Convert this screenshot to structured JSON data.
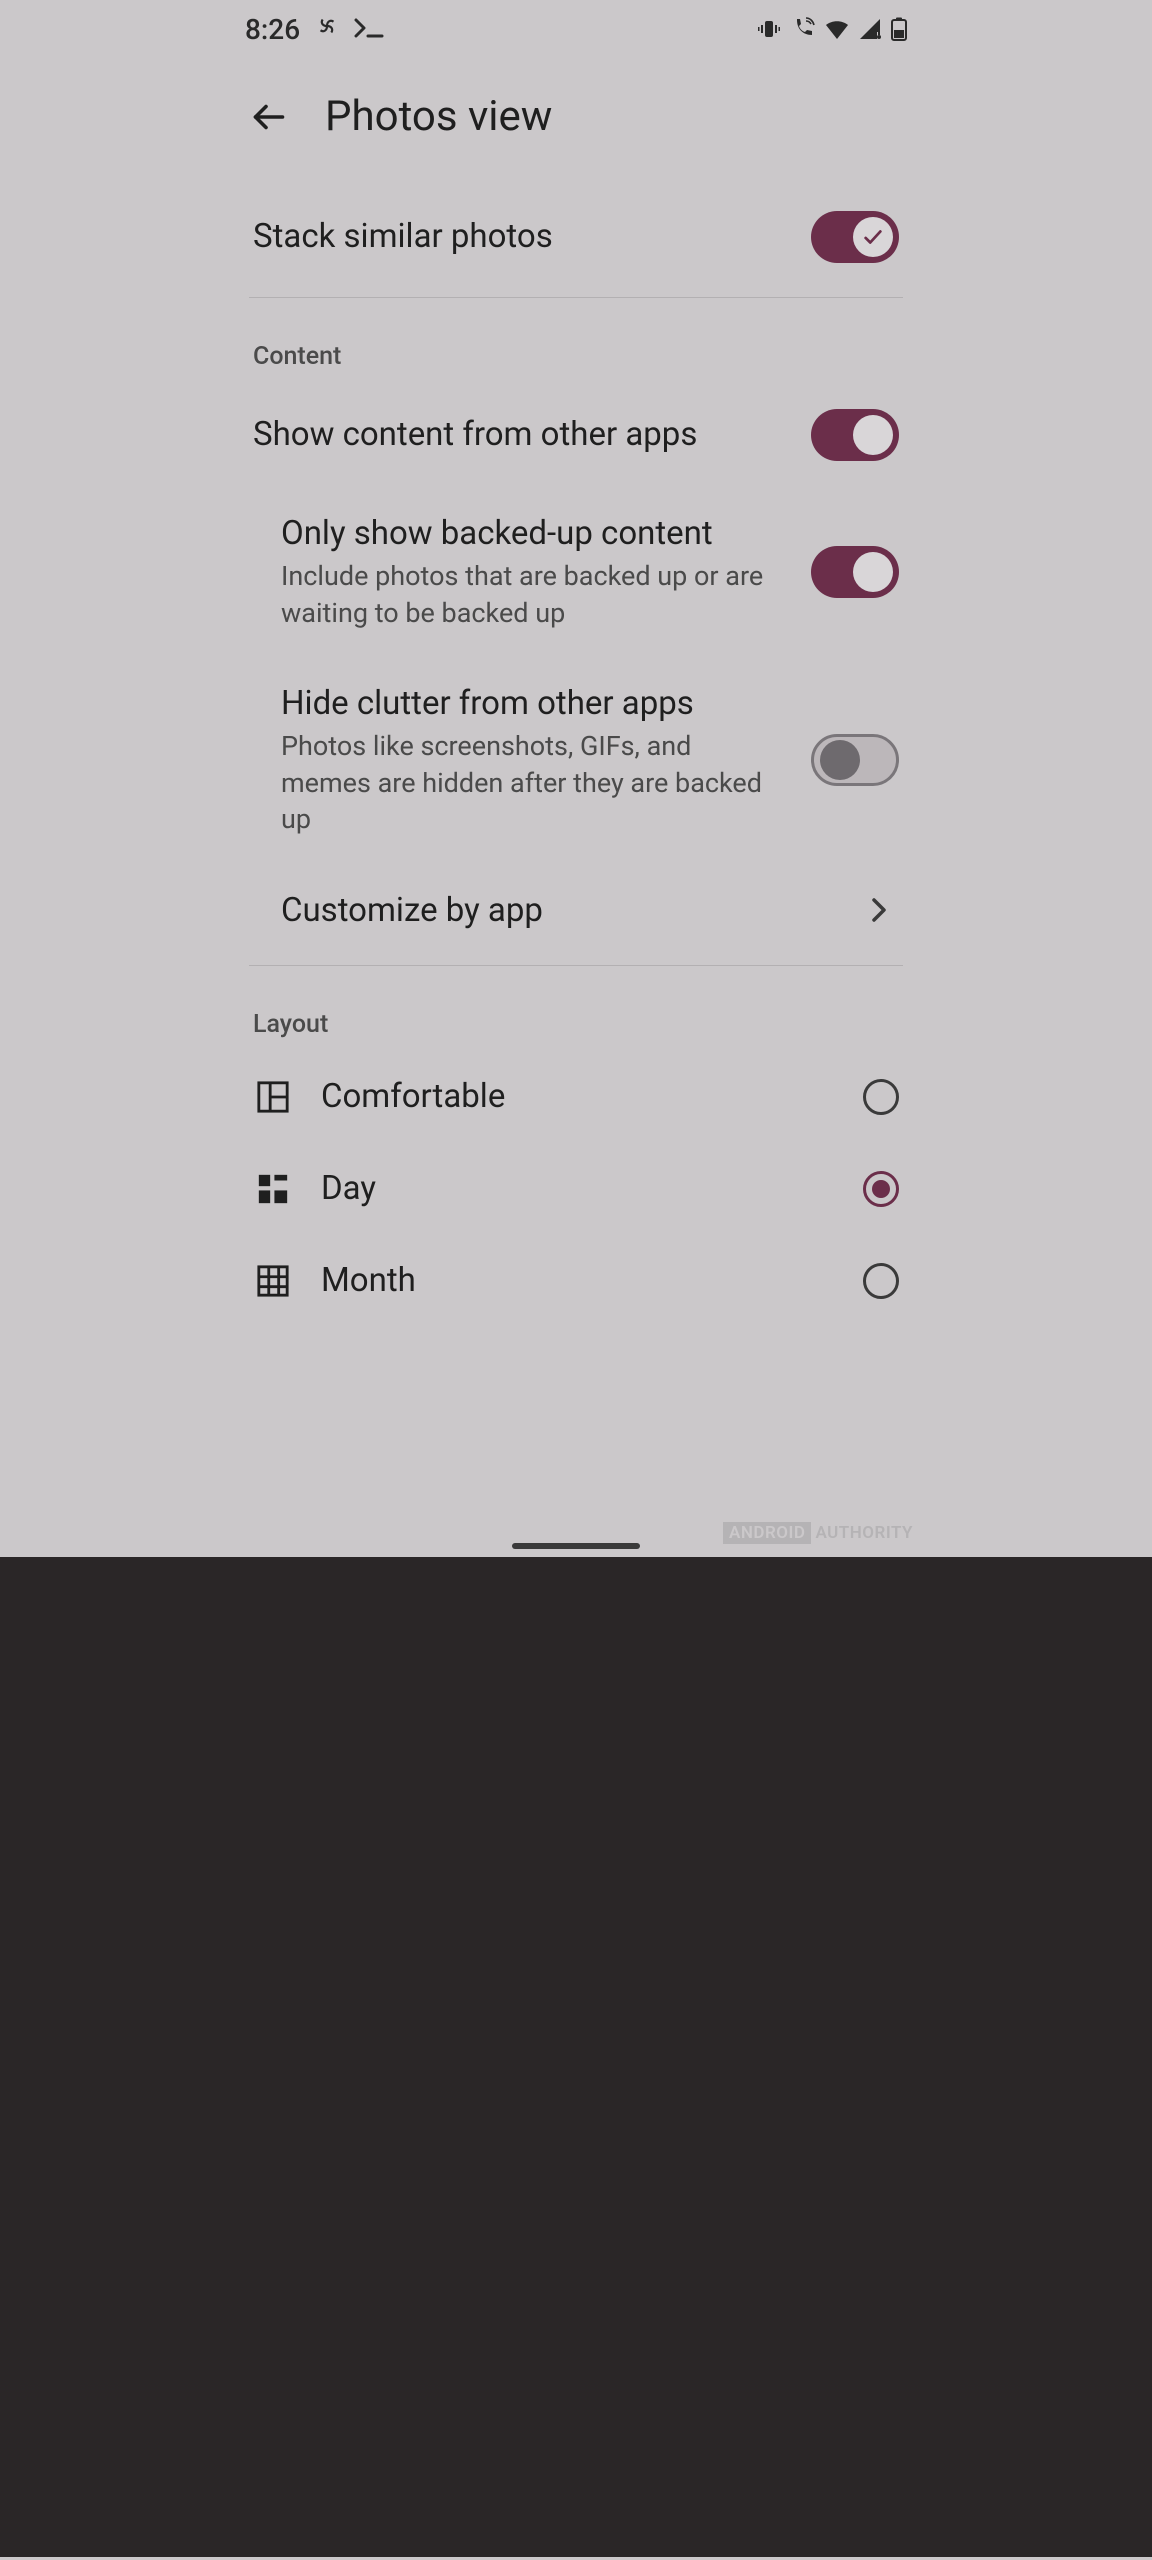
{
  "status": {
    "time": "8:26"
  },
  "header": {
    "title": "Photos view"
  },
  "stack_similar": {
    "title": "Stack similar photos",
    "on": true,
    "check": true
  },
  "sections": {
    "content_header": "Content",
    "layout_header": "Layout"
  },
  "content": {
    "show_other_apps": {
      "title": "Show content from other apps",
      "on": true
    },
    "only_backed_up": {
      "title": "Only show backed-up content",
      "sub": "Include photos that are backed up or are waiting to be backed up",
      "on": true
    },
    "hide_clutter": {
      "title": "Hide clutter from other apps",
      "sub": "Photos like screenshots, GIFs, and memes are hidden after they are backed up",
      "on": false
    },
    "customize": {
      "title": "Customize by app"
    }
  },
  "layout": {
    "selected": "day",
    "options": {
      "comfortable": {
        "label": "Comfortable"
      },
      "day": {
        "label": "Day"
      },
      "month": {
        "label": "Month"
      }
    }
  },
  "watermark": {
    "brand": "ANDROID",
    "name": "AUTHORITY"
  },
  "colors": {
    "accent": "#6b2e4a",
    "bg": "#cbc8ca"
  }
}
